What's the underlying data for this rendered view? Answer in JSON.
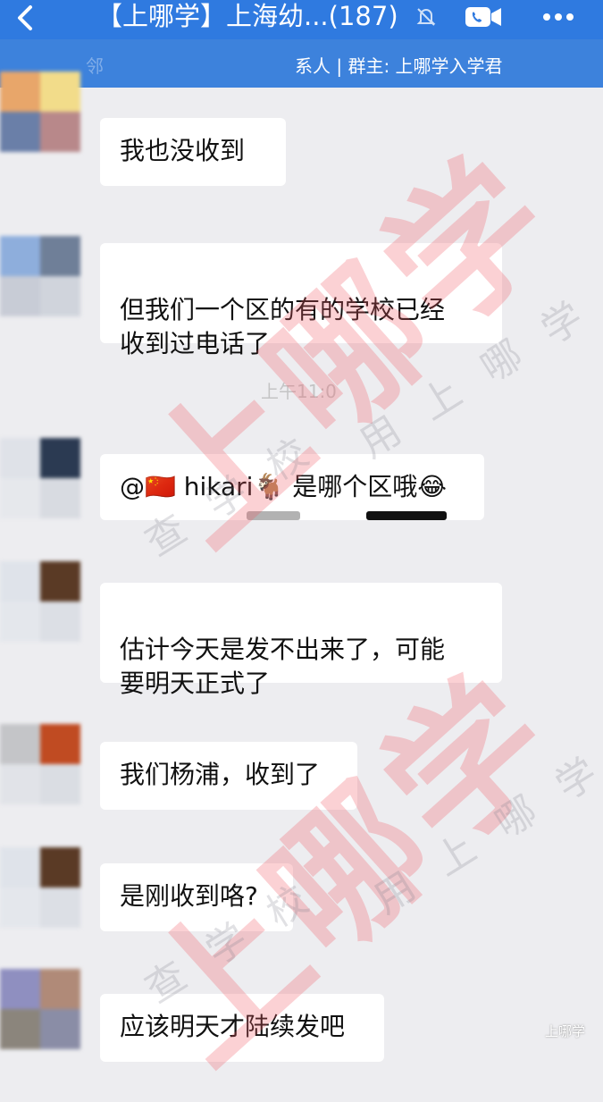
{
  "header": {
    "title": "【上哪学】上海幼...(187)",
    "subtitle_left": "邻",
    "subtitle_right": "系人 | 群主: 上哪学入学君",
    "icons": [
      "back-icon",
      "mute-icon",
      "video-call-icon",
      "more-icon"
    ]
  },
  "messages": [
    {
      "text": "我也没收到"
    },
    {
      "text": "但我们一个区的有的学校已经\n收到过电话了"
    },
    {
      "text": "@🇨🇳 hikari🐐 是哪个区哦😂"
    },
    {
      "text": "估计今天是发不出来了，可能\n要明天正式了"
    },
    {
      "text": "我们杨浦，收到了"
    },
    {
      "text": "是刚收到咯?"
    },
    {
      "text": "应该明天才陆续发吧"
    }
  ],
  "timestamp": "上午11:0",
  "watermark": {
    "brand": "上哪学",
    "slogan_a": "用上哪学",
    "slogan_b": "查学校"
  },
  "corner_mark": "上哪学",
  "colors": {
    "header_bg": "#2f7ae0",
    "subbar_bg": "#3d82dc",
    "chat_bg": "#ededf0",
    "bubble_bg": "#ffffff",
    "watermark_red": "#f05a64"
  }
}
